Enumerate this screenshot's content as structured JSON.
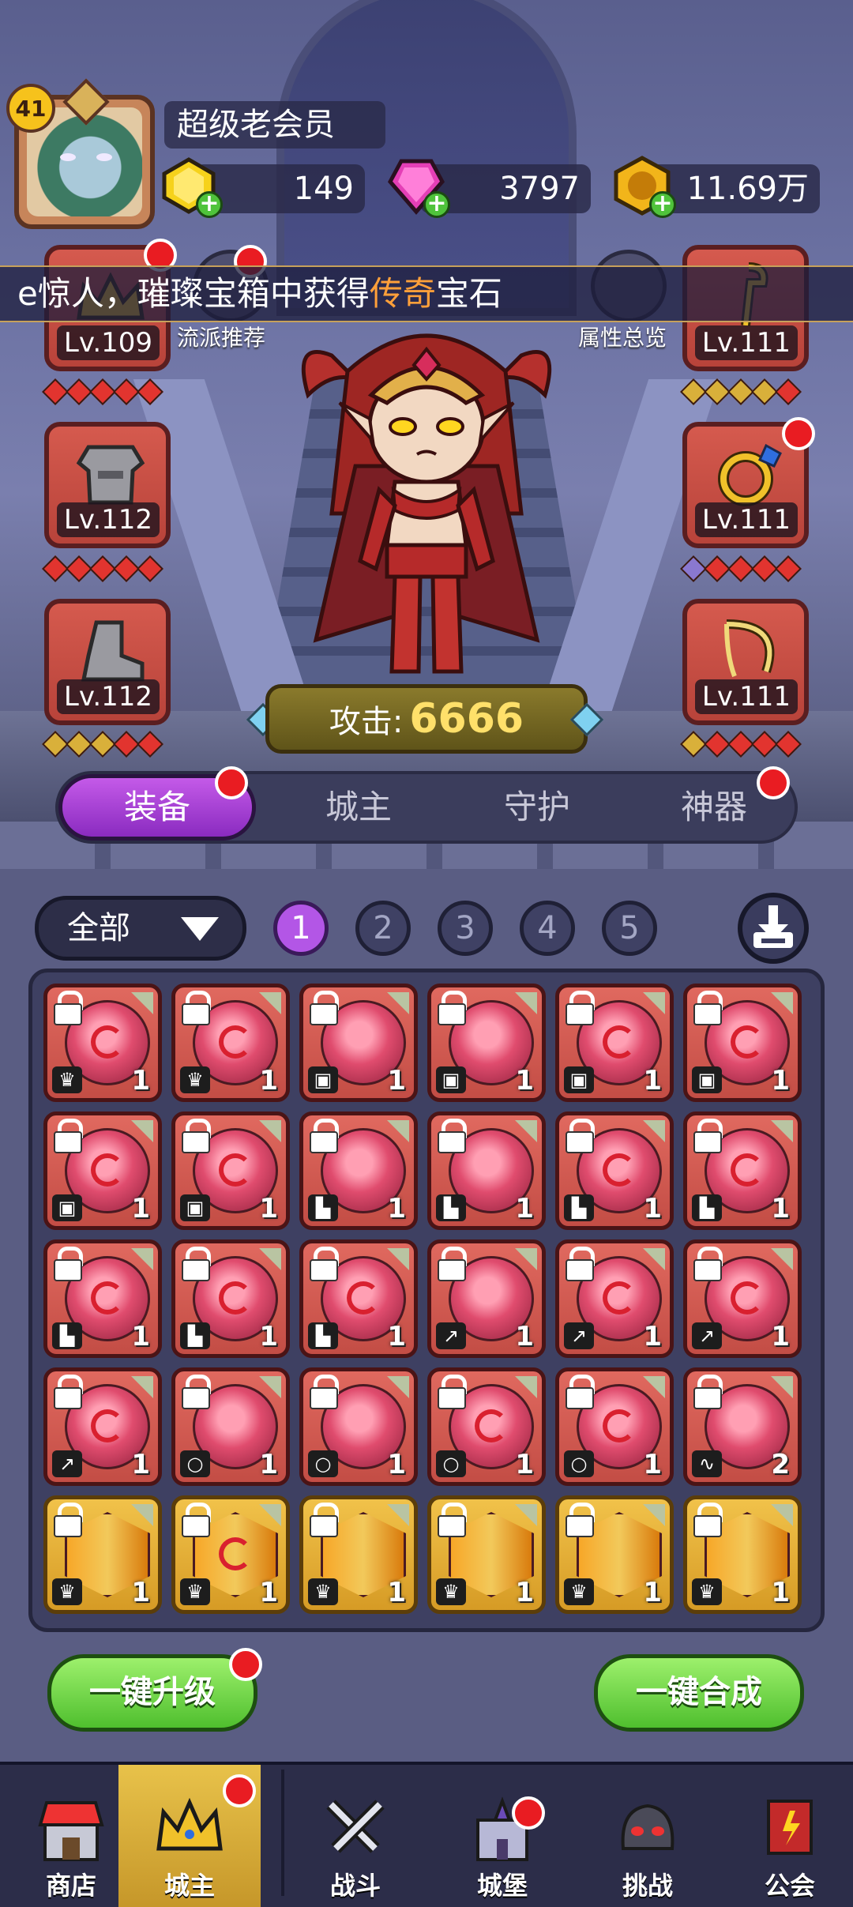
{
  "header": {
    "player_level": "41",
    "player_name": "超级老会员",
    "resources": [
      {
        "name": "gold-gem",
        "value": "149"
      },
      {
        "name": "pink-gem",
        "value": "3797"
      },
      {
        "name": "coin",
        "value": "11.69万"
      }
    ]
  },
  "ticker": {
    "prefix": "e惊人，璀璨宝箱中获得",
    "highlight": "传奇",
    "suffix": "宝石"
  },
  "side_labels": {
    "recommend": "流派推荐",
    "attributes": "属性总览"
  },
  "equipment": {
    "left": [
      {
        "slot": "crown",
        "level": "Lv.109"
      },
      {
        "slot": "armor",
        "level": "Lv.112"
      },
      {
        "slot": "boots",
        "level": "Lv.112"
      }
    ],
    "right": [
      {
        "slot": "staff",
        "level": "Lv.111"
      },
      {
        "slot": "ring",
        "level": "Lv.111"
      },
      {
        "slot": "necklace",
        "level": "Lv.111"
      }
    ]
  },
  "attack": {
    "label": "攻击:",
    "value": "6666"
  },
  "tabs": [
    "装备",
    "城主",
    "守护",
    "神器"
  ],
  "filter": {
    "label": "全部"
  },
  "pages": [
    "1",
    "2",
    "3",
    "4",
    "5"
  ],
  "grid": {
    "rows": [
      [
        {
          "color": "red",
          "swirl": true,
          "type": "crown",
          "count": "1"
        },
        {
          "color": "red",
          "swirl": true,
          "type": "crown",
          "count": "1"
        },
        {
          "color": "red",
          "swirl": false,
          "type": "armor",
          "count": "1"
        },
        {
          "color": "red",
          "swirl": false,
          "type": "armor",
          "count": "1"
        },
        {
          "color": "red",
          "swirl": true,
          "type": "armor",
          "count": "1"
        },
        {
          "color": "red",
          "swirl": true,
          "type": "armor",
          "count": "1"
        }
      ],
      [
        {
          "color": "red",
          "swirl": true,
          "type": "armor",
          "count": "1"
        },
        {
          "color": "red",
          "swirl": true,
          "type": "armor",
          "count": "1"
        },
        {
          "color": "red",
          "swirl": false,
          "type": "boots",
          "count": "1"
        },
        {
          "color": "red",
          "swirl": false,
          "type": "boots",
          "count": "1"
        },
        {
          "color": "red",
          "swirl": true,
          "type": "boots",
          "count": "1"
        },
        {
          "color": "red",
          "swirl": true,
          "type": "boots",
          "count": "1"
        }
      ],
      [
        {
          "color": "red",
          "swirl": true,
          "type": "boots",
          "count": "1"
        },
        {
          "color": "red",
          "swirl": true,
          "type": "boots",
          "count": "1"
        },
        {
          "color": "red",
          "swirl": true,
          "type": "boots",
          "count": "1"
        },
        {
          "color": "red",
          "swirl": false,
          "type": "staff",
          "count": "1"
        },
        {
          "color": "red",
          "swirl": true,
          "type": "staff",
          "count": "1"
        },
        {
          "color": "red",
          "swirl": true,
          "type": "staff",
          "count": "1"
        }
      ],
      [
        {
          "color": "red",
          "swirl": true,
          "type": "staff",
          "count": "1"
        },
        {
          "color": "red",
          "swirl": false,
          "type": "ring",
          "count": "1"
        },
        {
          "color": "red",
          "swirl": false,
          "type": "ring",
          "count": "1"
        },
        {
          "color": "red",
          "swirl": true,
          "type": "ring",
          "count": "1"
        },
        {
          "color": "red",
          "swirl": true,
          "type": "ring",
          "count": "1"
        },
        {
          "color": "red",
          "swirl": false,
          "type": "necklace",
          "count": "2"
        }
      ],
      [
        {
          "color": "gold",
          "swirl": false,
          "type": "crown",
          "count": "1"
        },
        {
          "color": "gold",
          "swirl": true,
          "type": "crown",
          "count": "1"
        },
        {
          "color": "gold",
          "swirl": false,
          "type": "crown",
          "count": "1"
        },
        {
          "color": "gold",
          "swirl": false,
          "type": "crown",
          "count": "1"
        },
        {
          "color": "gold",
          "swirl": false,
          "type": "crown",
          "count": "1"
        },
        {
          "color": "gold",
          "swirl": false,
          "type": "crown",
          "count": "1"
        }
      ]
    ]
  },
  "actions": {
    "upgrade_all": "一键升级",
    "merge_all": "一键合成"
  },
  "nav": [
    "商店",
    "城主",
    "战斗",
    "城堡",
    "挑战",
    "公会"
  ],
  "colors": {
    "red_dot": "#e91c22",
    "tab_active": "#b356e6",
    "action_green": "#4fbf2e",
    "attack_value": "#ffe06a",
    "ticker_highlight": "#ffa03a"
  }
}
